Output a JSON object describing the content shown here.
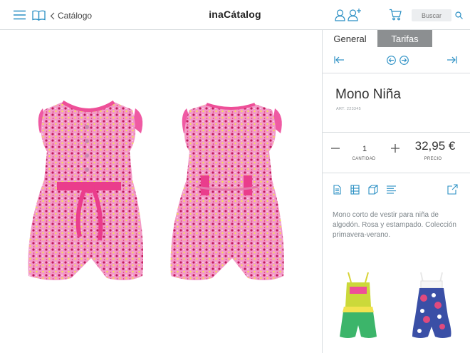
{
  "header": {
    "back_label": "Catálogo",
    "title": "inaCátalog",
    "search_placeholder": "Buscar"
  },
  "icons": {
    "menu": "hamburger-menu-icon",
    "book": "open-book-icon",
    "back": "chevron-left-icon",
    "user": "user-icon",
    "add_user": "add-user-icon",
    "cart": "cart-icon",
    "search": "magnifier-icon"
  },
  "colors": {
    "accent": "#2a8fc4",
    "tab_active_bg": "#8c8f91",
    "divider": "#d9dde0"
  },
  "panel": {
    "tabs": [
      {
        "label": "General",
        "active": false
      },
      {
        "label": "Tarifas",
        "active": true
      }
    ],
    "product_name": "Mono Niña",
    "product_ref": "ART. 223345",
    "quantity": "1",
    "quantity_label": "CANTIDAD",
    "price": "32,95 €",
    "price_label": "PRECIO",
    "description": "Mono corto de vestir para niña de algodón. Rosa y estampado. Colección primavera-verano."
  },
  "main": {
    "images": [
      "romper-front-image",
      "romper-back-image"
    ]
  },
  "related": {
    "items": [
      "green-yellow-romper-thumbnail",
      "patterned-romper-thumbnail"
    ]
  }
}
